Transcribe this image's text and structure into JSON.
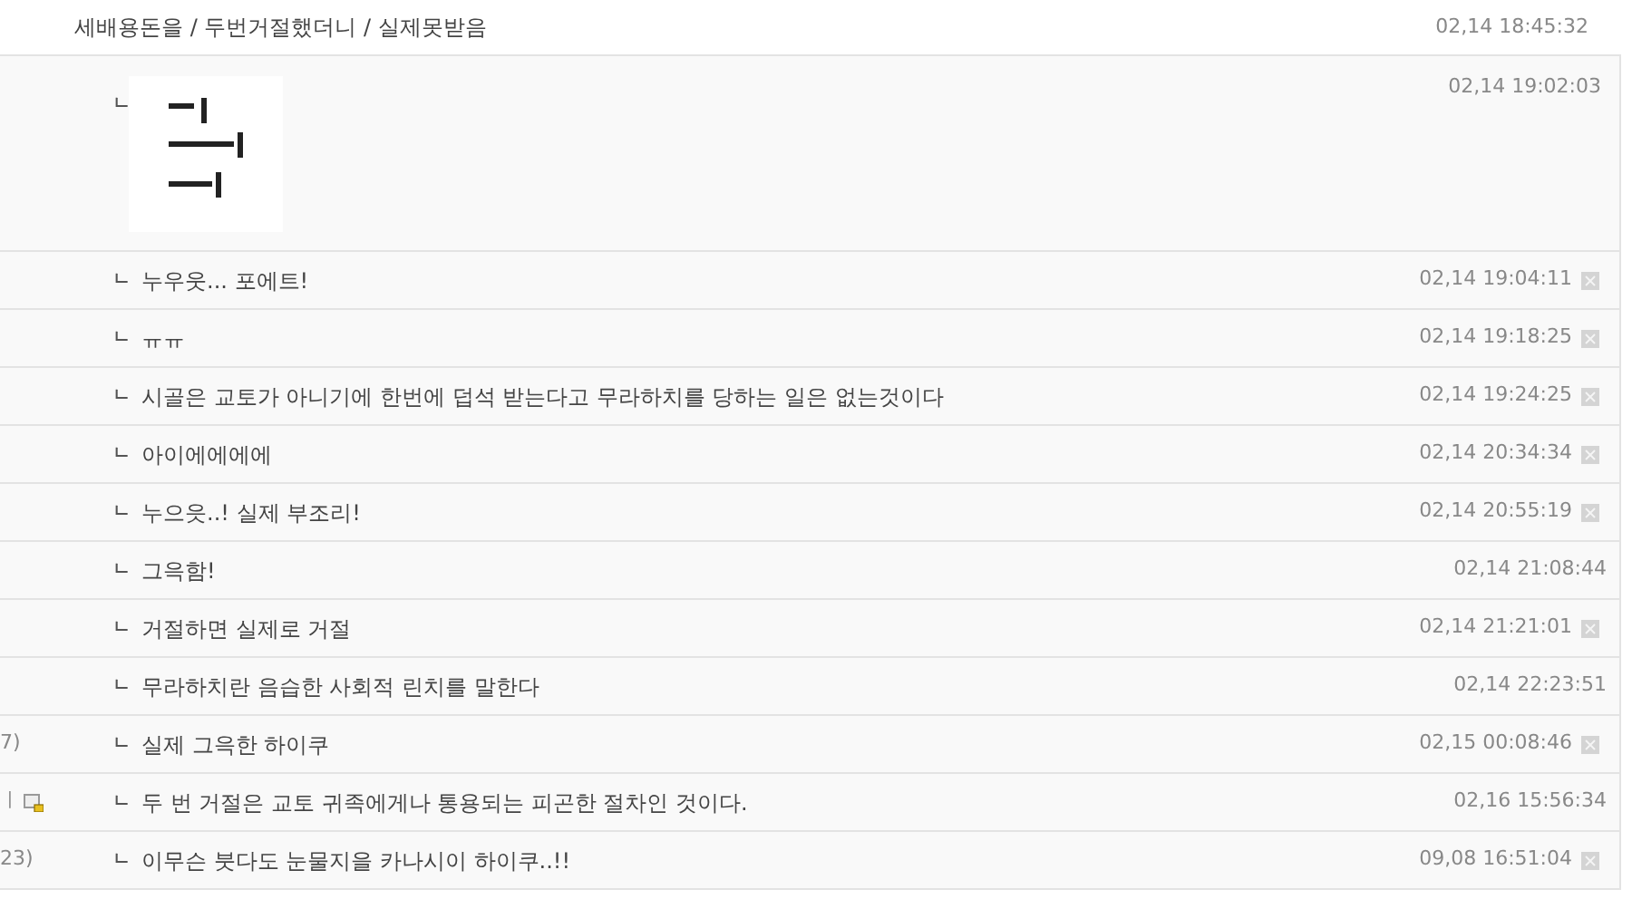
{
  "post": {
    "title": "세배용돈을 / 두번거절했더니 / 실제못받음",
    "time": "02,14 18:45:32"
  },
  "image_reply": {
    "marker": "ㄴ",
    "time": "02,14 19:02:03"
  },
  "replies": [
    {
      "marker": "ㄴ",
      "text": "누우웃... 포에트!",
      "time": "02,14 19:04:11",
      "deletable": true,
      "has_attachment": false
    },
    {
      "marker": "ㄴ",
      "text": "ㅠㅠ",
      "time": "02,14 19:18:25",
      "deletable": true,
      "has_attachment": false
    },
    {
      "marker": "ㄴ",
      "text": "시골은 교토가 아니기에 한번에 덥석 받는다고 무라하치를 당하는 일은 없는것이다",
      "time": "02,14 19:24:25",
      "deletable": true,
      "has_attachment": false
    },
    {
      "marker": "ㄴ",
      "text": "아이에에에에",
      "time": "02,14 20:34:34",
      "deletable": true,
      "has_attachment": false
    },
    {
      "marker": "ㄴ",
      "text": "누으읏..! 실제 부조리!",
      "time": "02,14 20:55:19",
      "deletable": true,
      "has_attachment": false
    },
    {
      "marker": "ㄴ",
      "text": "그윽함!",
      "time": "02,14 21:08:44",
      "deletable": false,
      "has_attachment": false
    },
    {
      "marker": "ㄴ",
      "text": "거절하면 실제로 거절",
      "time": "02,14 21:21:01",
      "deletable": true,
      "has_attachment": false
    },
    {
      "marker": "ㄴ",
      "text": "무라하치란 음습한 사회적 린치를 말한다",
      "time": "02,14 22:23:51",
      "deletable": false,
      "has_attachment": false
    },
    {
      "left_fragment": "7)",
      "marker": "ㄴ",
      "text": "실제 그윽한 하이쿠",
      "time": "02,15 00:08:46",
      "deletable": true,
      "has_attachment": false
    },
    {
      "left_fragment": "ㅣ",
      "marker": "ㄴ",
      "text": "두 번 거절은 교토 귀족에게나 통용되는 피곤한 절차인 것이다.",
      "time": "02,16 15:56:34",
      "deletable": false,
      "has_attachment": true
    },
    {
      "left_fragment": "23)",
      "marker": "ㄴ",
      "text": "이무슨 붓다도 눈물지을 카나시이 하이쿠..!!",
      "time": "09,08 16:51:04",
      "deletable": true,
      "has_attachment": false
    }
  ]
}
